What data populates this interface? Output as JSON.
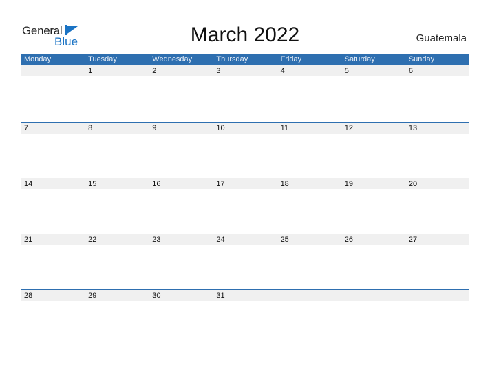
{
  "logo": {
    "general": "General",
    "blue": "Blue"
  },
  "title": "March 2022",
  "country": "Guatemala",
  "colors": {
    "accent": "#2e6fb0",
    "strip": "#f0f0f0",
    "logo_blue": "#1a73c4"
  },
  "weekdays": [
    "Monday",
    "Tuesday",
    "Wednesday",
    "Thursday",
    "Friday",
    "Saturday",
    "Sunday"
  ],
  "weeks": [
    [
      "",
      "1",
      "2",
      "3",
      "4",
      "5",
      "6"
    ],
    [
      "7",
      "8",
      "9",
      "10",
      "11",
      "12",
      "13"
    ],
    [
      "14",
      "15",
      "16",
      "17",
      "18",
      "19",
      "20"
    ],
    [
      "21",
      "22",
      "23",
      "24",
      "25",
      "26",
      "27"
    ],
    [
      "28",
      "29",
      "30",
      "31",
      "",
      "",
      ""
    ]
  ]
}
